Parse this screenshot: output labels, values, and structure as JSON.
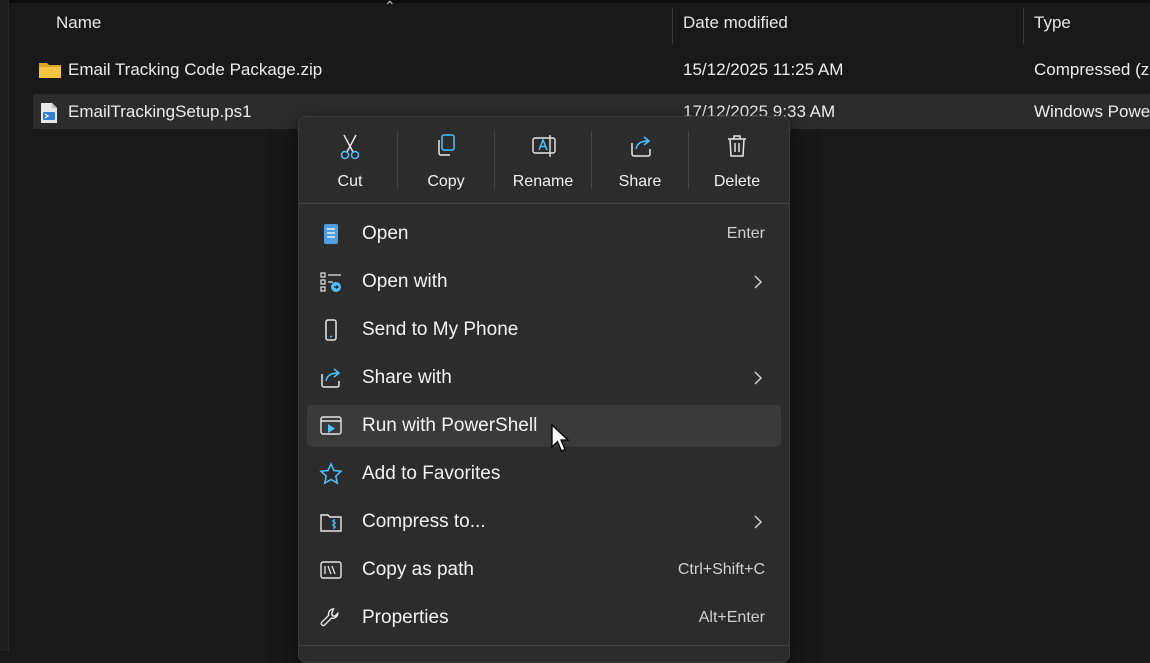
{
  "columns": {
    "name": "Name",
    "date_modified": "Date modified",
    "type": "Type"
  },
  "files": [
    {
      "name": "Email Tracking Code Package.zip",
      "date": "15/12/2025 11:25 AM",
      "type": "Compressed (zip",
      "icon": "zip-folder-icon",
      "selected": false
    },
    {
      "name": "EmailTrackingSetup.ps1",
      "date": "17/12/2025 9:33 AM",
      "type": "Windows Powe",
      "icon": "powershell-script-icon",
      "selected": true
    }
  ],
  "context_menu": {
    "quick_actions": [
      {
        "label": "Cut",
        "icon": "scissors-icon"
      },
      {
        "label": "Copy",
        "icon": "copy-icon"
      },
      {
        "label": "Rename",
        "icon": "rename-icon"
      },
      {
        "label": "Share",
        "icon": "share-icon"
      },
      {
        "label": "Delete",
        "icon": "trash-icon"
      }
    ],
    "items": [
      {
        "label": "Open",
        "shortcut": "Enter",
        "icon": "notepad-icon"
      },
      {
        "label": "Open with",
        "shortcut": "",
        "icon": "open-with-icon",
        "submenu": true
      },
      {
        "label": "Send to My Phone",
        "shortcut": "",
        "icon": "phone-icon"
      },
      {
        "label": "Share with",
        "shortcut": "",
        "icon": "share-with-icon",
        "submenu": true
      },
      {
        "label": "Run with PowerShell",
        "shortcut": "",
        "icon": "powershell-run-icon",
        "hovered": true
      },
      {
        "label": "Add to Favorites",
        "shortcut": "",
        "icon": "star-icon"
      },
      {
        "label": "Compress to...",
        "shortcut": "",
        "icon": "compress-icon",
        "submenu": true
      },
      {
        "label": "Copy as path",
        "shortcut": "Ctrl+Shift+C",
        "icon": "copy-path-icon"
      },
      {
        "label": "Properties",
        "shortcut": "Alt+Enter",
        "icon": "wrench-icon"
      }
    ]
  },
  "colors": {
    "background": "#191919",
    "menu_background": "#2c2c2c",
    "accent": "#4cc2ff",
    "folder": "#f5c542"
  }
}
